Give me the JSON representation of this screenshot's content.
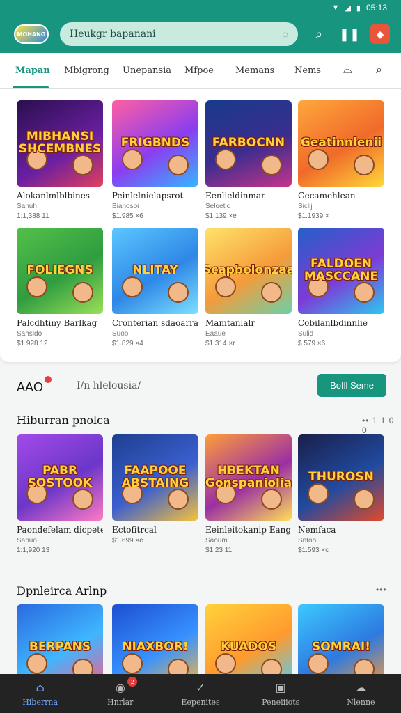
{
  "status": {
    "time": "05:13"
  },
  "header": {
    "logo_text": "MOHANG",
    "search_placeholder": "Heukgr bapanani"
  },
  "tabs": [
    "Mapan",
    "Mbigrong",
    "Unepansia",
    "Mfpoe",
    "Memans",
    "Nems"
  ],
  "grid": {
    "tiles": [
      {
        "art": "MIBHANSI SHCEMBNES",
        "name": "Alokanlmlblbines",
        "sub": "Sanuh",
        "meta": "1:1,388 11",
        "bg": "linear-gradient(150deg,#2a0f4d,#6a1fa2 60%,#e2405c)"
      },
      {
        "art": "FRIGBNDS",
        "name": "Peinlelnielapsrot",
        "sub": "Bianosoi",
        "meta": "$1.985 ×6",
        "bg": "linear-gradient(150deg,#ff5fa2,#8b3df0 55%,#35b6ff)"
      },
      {
        "art": "FARBOCNN",
        "name": "Eenlieldinmar",
        "sub": "Seloetic",
        "meta": "$1.139 ×e",
        "bg": "linear-gradient(160deg,#183a8c,#3b2d8e 55%,#c5348a)"
      },
      {
        "art": "Geatinnlenii",
        "name": "Gecamehlean",
        "sub": "Siclij",
        "meta": "$1.1939 ×",
        "bg": "linear-gradient(150deg,#ffa73c,#f06a2a 55%,#ffd83a)"
      },
      {
        "art": "FOLIEGNS",
        "name": "Palcdhtiny Barlkag",
        "sub": "Sahsldo",
        "meta": "$1.928 12",
        "bg": "linear-gradient(150deg,#53c04a,#2f9d3f 55%,#9ae05a)"
      },
      {
        "art": "NLITAY",
        "name": "Cronterian sdaoarran",
        "sub": "Suoo",
        "meta": "$1.829 ×4",
        "bg": "linear-gradient(150deg,#5cc7ff,#2e87e6 55%,#7de0ff)"
      },
      {
        "art": "Scapbolonzaa",
        "name": "Mamtanlalr",
        "sub": "Eaaue",
        "meta": "$1.314 ×r",
        "bg": "linear-gradient(150deg,#ffe36a,#f59b3a 55%,#6bd0a8)"
      },
      {
        "art": "FALDOEN MASCCANE",
        "name": "Cobilanlbdinnlie",
        "sub": "Sulid",
        "meta": "$ 579 ×6",
        "bg": "linear-gradient(150deg,#2460c7,#7d3bd6 55%,#2cc9ef)"
      }
    ]
  },
  "promo": {
    "title": "AAO",
    "subtitle": "I/n hlelousia/",
    "button": "BoIll Seme"
  },
  "section1": {
    "title": "Hiburran pnolca",
    "more": "•• 1 1 0 0",
    "tiles": [
      {
        "art": "PABR SOSTOOK",
        "name": "Paondefelam dicpete",
        "sub": "Sanuo",
        "meta": "1:1,920 13",
        "bg": "linear-gradient(150deg,#a34be8,#6b36c9 55%,#ff7bc3)"
      },
      {
        "art": "FAAPOOE ABSTAING",
        "name": "Ectofitrcal",
        "sub": "",
        "meta": "$1.699 ×e",
        "bg": "linear-gradient(150deg,#1e3f8f,#3b5fd0 55%,#f7c23a)"
      },
      {
        "art": "HBEKTAN Gonspaniolia",
        "name": "Eeinleitokanip Eang",
        "sub": "Saoum",
        "meta": "$1.23 11",
        "bg": "linear-gradient(150deg,#ff9d3a,#9b2fa4 55%,#ffde55)"
      },
      {
        "art": "THUROSN",
        "name": "Nemfaca",
        "sub": "Sntoo",
        "meta": "$1.593 ×c",
        "bg": "linear-gradient(150deg,#1a1f4a,#204a9f 55%,#e34a2a)"
      }
    ]
  },
  "section2": {
    "title": "Dpnleirca Arlnp",
    "more": "•••",
    "tiles": [
      {
        "art": "BERPANS",
        "bg": "linear-gradient(150deg,#2a6ae0,#3fb6ff 55%,#ff5a8a)"
      },
      {
        "art": "NIAXBOR!",
        "bg": "linear-gradient(150deg,#1d4fd1,#3792ff 55%,#ffb93a)"
      },
      {
        "art": "KUADOS",
        "bg": "linear-gradient(150deg,#ffd23a,#ff9a2e 55%,#4ad0ff)"
      },
      {
        "art": "SOMRAI!",
        "bg": "linear-gradient(150deg,#3dc8ff,#2d7ae0 55%,#ff9b3a)"
      }
    ]
  },
  "bottom_nav": [
    {
      "label": "Hiberrna",
      "icon": "home-icon",
      "glyph": "⌂",
      "active": true
    },
    {
      "label": "Hnrlar",
      "icon": "profile-icon",
      "glyph": "◉",
      "badge": "2"
    },
    {
      "label": "Eepenites",
      "icon": "compass-icon",
      "glyph": "✓"
    },
    {
      "label": "Peneiiiots",
      "icon": "store-icon",
      "glyph": "▣"
    },
    {
      "label": "Nlenne",
      "icon": "games-icon",
      "glyph": "☁"
    }
  ],
  "colors": {
    "primary": "#17957f",
    "nav_bg": "#232323",
    "accent_red": "#e9553a"
  }
}
